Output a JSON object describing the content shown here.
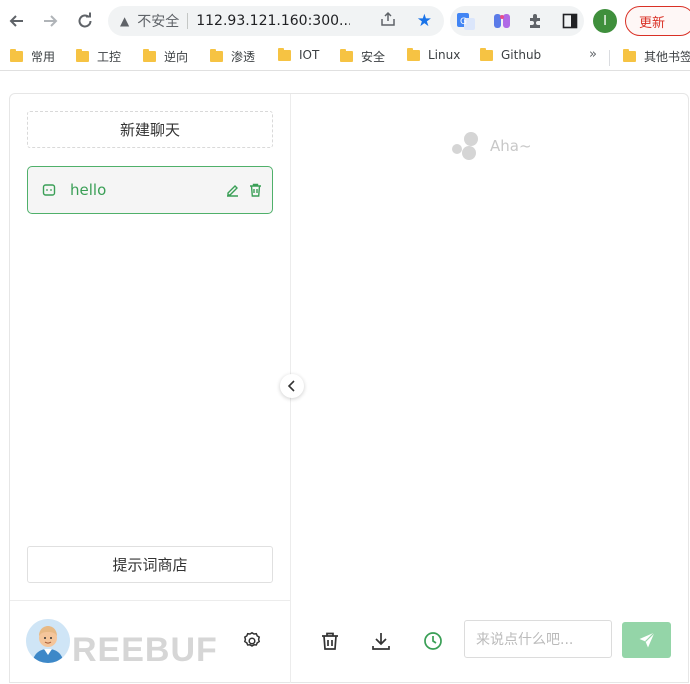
{
  "browser": {
    "security_label": "不安全",
    "url": "112.93.121.160:300...",
    "update_label": "更新",
    "profile_initial": "I",
    "bookmarks": [
      "常用",
      "工控",
      "逆向",
      "渗透",
      "IOT",
      "安全",
      "Linux",
      "Github"
    ],
    "overflow_chevron": "»",
    "other_bookmarks": "其他书签"
  },
  "sidebar": {
    "new_chat_label": "新建聊天",
    "chats": [
      {
        "title": "hello",
        "icon": "chat-bubble-icon",
        "active": true
      }
    ],
    "prompt_store_label": "提示词商店",
    "watermark": "REEBUF"
  },
  "main": {
    "empty_text": "Aha~",
    "input_placeholder": "来说点什么吧...",
    "actions": [
      "clear-icon",
      "download-icon",
      "history-icon"
    ]
  },
  "colors": {
    "accent": "#3a9f56",
    "send_button": "#94d5a8",
    "update_red": "#d93025"
  }
}
